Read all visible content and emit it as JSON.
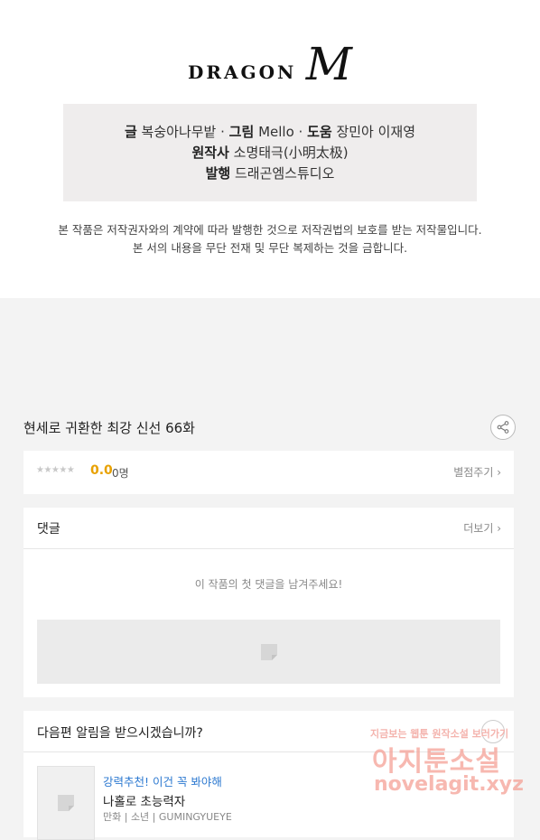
{
  "logo": {
    "text": "DRAGON",
    "mark": "M"
  },
  "credits": {
    "line1": {
      "label1": "글",
      "value1": "복숭아나무밭",
      "sep1": " · ",
      "label2": "그림",
      "value2": "Mello",
      "sep2": " · ",
      "label3": "도움",
      "value3": "장민아 이재영"
    },
    "line2": {
      "label": "원작사",
      "value": "소명태극(小明太极)"
    },
    "line3": {
      "label": "발행",
      "value": "드래곤엠스튜디오"
    }
  },
  "notice": {
    "line1": "본 작품은 저작권자와의 계약에 따라 발행한 것으로 저작권법의 보호를 받는 저작물입니다.",
    "line2": "본 서의 내용을 무단 전재 및 무단 복제하는 것을 금합니다."
  },
  "episode": {
    "title": "현세로 귀환한 최강 신선 66화",
    "share_icon": "share-icon"
  },
  "rating": {
    "stars": "★★★★★",
    "score": "0.0",
    "count": "0명",
    "link": "별점주기 ›"
  },
  "comments": {
    "title": "댓글",
    "more": "더보기 ›",
    "empty": "이 작품의 첫 댓글을 남겨주세요!"
  },
  "notify": {
    "title": "다음편 알림을 받으시겠습니까?",
    "recommend": {
      "tag": "강력추천! 이건 꼭 봐야해",
      "title": "나홀로 초능력자",
      "meta": "만화 | 소년 | GUMINGYUEYE"
    }
  },
  "watermark": {
    "small": "지금보는 웹툰 원작소설 보러가기",
    "big": "아지툰소설",
    "url": "novelagit.xyz"
  },
  "colors": {
    "accent_score": "#e8a100",
    "link_blue": "#2b78d0",
    "credit_bg": "#efeded",
    "page_bg": "#f3f3f3"
  }
}
